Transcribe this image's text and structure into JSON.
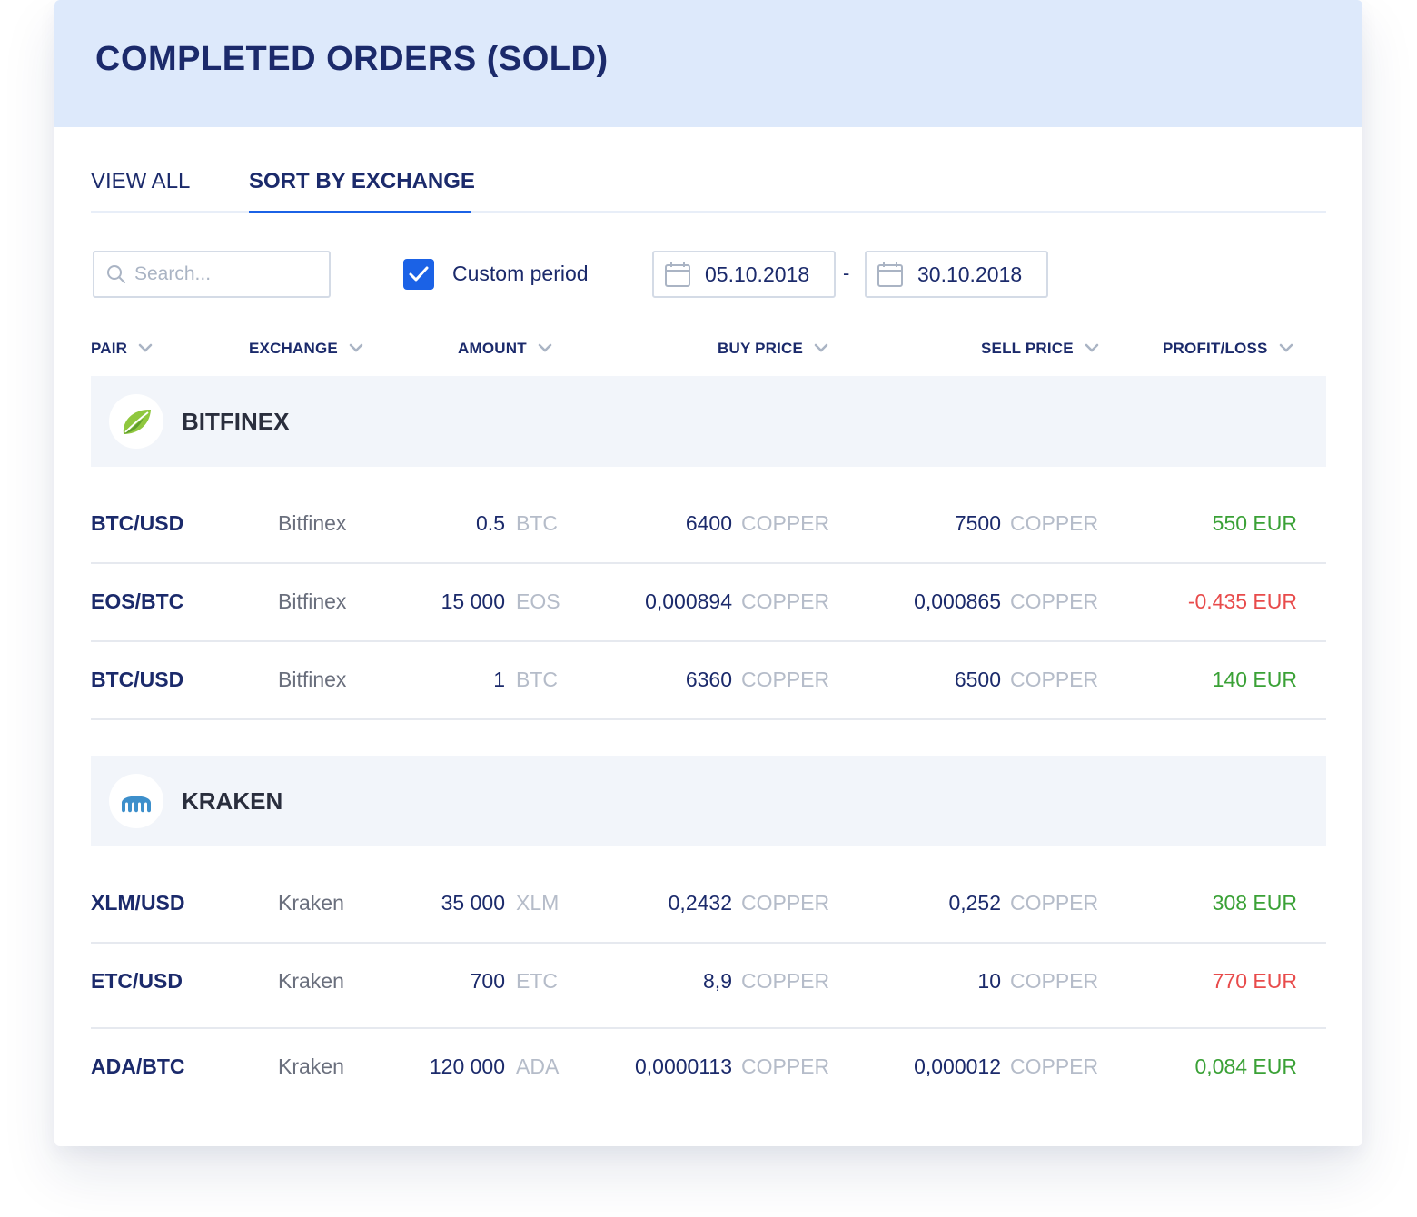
{
  "title": "COMPLETED ORDERS (SOLD)",
  "tabs": [
    {
      "label": "VIEW ALL",
      "active": false
    },
    {
      "label": "SORT BY EXCHANGE",
      "active": true
    }
  ],
  "filters": {
    "search_placeholder": "Search...",
    "custom_period_label": "Custom period",
    "custom_period_checked": true,
    "date_from": "05.10.2018",
    "date_separator": "-",
    "date_to": "30.10.2018"
  },
  "columns": [
    "PAIR",
    "EXCHANGE",
    "AMOUNT",
    "BUY PRICE",
    "SELL PRICE",
    "PROFIT/LOSS"
  ],
  "colors": {
    "accent": "#1b62e6",
    "profit": "#3aa136",
    "loss": "#e84b4b",
    "navy": "#1b2a6b"
  },
  "groups": [
    {
      "name": "BITFINEX",
      "logo_icon": "bitfinex-leaf-icon",
      "rows": [
        {
          "pair": "BTC/USD",
          "exchange": "Bitfinex",
          "amount": "0.5",
          "amount_unit": "BTC",
          "buy": "6400",
          "buy_unit": "COPPER",
          "sell": "7500",
          "sell_unit": "COPPER",
          "pl": "550 EUR",
          "pl_status": "profit"
        },
        {
          "pair": "EOS/BTC",
          "exchange": "Bitfinex",
          "amount": "15 000",
          "amount_unit": "EOS",
          "buy": "0,000894",
          "buy_unit": "COPPER",
          "sell": "0,000865",
          "sell_unit": "COPPER",
          "pl": "-0.435 EUR",
          "pl_status": "loss"
        },
        {
          "pair": "BTC/USD",
          "exchange": "Bitfinex",
          "amount": "1",
          "amount_unit": "BTC",
          "buy": "6360",
          "buy_unit": "COPPER",
          "sell": "6500",
          "sell_unit": "COPPER",
          "pl": "140 EUR",
          "pl_status": "profit"
        }
      ]
    },
    {
      "name": "KRAKEN",
      "logo_icon": "kraken-icon",
      "rows": [
        {
          "pair": "XLM/USD",
          "exchange": "Kraken",
          "amount": "35 000",
          "amount_unit": "XLM",
          "buy": "0,2432",
          "buy_unit": "COPPER",
          "sell": "0,252",
          "sell_unit": "COPPER",
          "pl": "308 EUR",
          "pl_status": "profit"
        },
        {
          "pair": "ETC/USD",
          "exchange": "Kraken",
          "amount": "700",
          "amount_unit": "ETC",
          "buy": "8,9",
          "buy_unit": "COPPER",
          "sell": "10",
          "sell_unit": "COPPER",
          "pl": "770 EUR",
          "pl_status": "loss"
        },
        {
          "pair": "ADA/BTC",
          "exchange": "Kraken",
          "amount": "120 000",
          "amount_unit": "ADA",
          "buy": "0,0000113",
          "buy_unit": "COPPER",
          "sell": "0,000012",
          "sell_unit": "COPPER",
          "pl": "0,084 EUR",
          "pl_status": "profit"
        }
      ]
    }
  ]
}
